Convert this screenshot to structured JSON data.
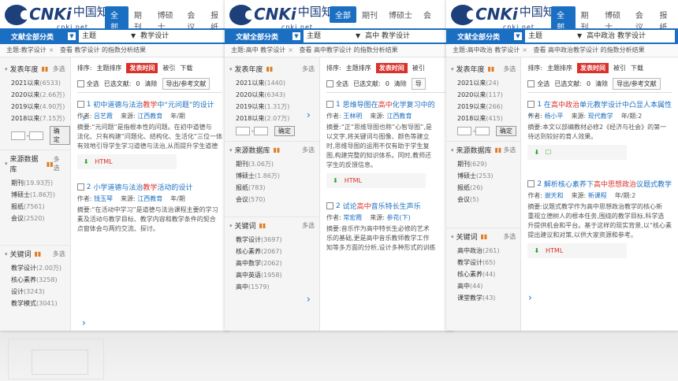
{
  "colors": {
    "accent": "#1b6fc2",
    "highlight": "#d9312a",
    "download": "#2aa52a"
  },
  "logo": {
    "brand": "CNKi",
    "chinese": "中国知网",
    "sub": "cnki.net"
  },
  "panels": [
    {
      "tabs": [
        "全部",
        "期刊",
        "博硕士",
        "会议",
        "报纸"
      ],
      "scope": "文献全部分类",
      "field": "主题",
      "search_value": "教学设计",
      "crumb": {
        "label": "主题:教学设计",
        "link": "查看 教学设计 的指数分析结果",
        "highlight": "教学设计"
      },
      "facets": {
        "year": {
          "title": "发表年度",
          "multi": "多选",
          "items": [
            [
              "2021以来",
              "(6533)"
            ],
            [
              "2020以来",
              "(2.66万)"
            ],
            [
              "2019以来",
              "(4.90万)"
            ],
            [
              "2018以来",
              "(7.15万)"
            ]
          ],
          "ok": "确定"
        },
        "source": {
          "title": "来源数据库",
          "multi": "多选",
          "items": [
            [
              "期刊",
              "(19.93万)"
            ],
            [
              "博硕士",
              "(1.86万)"
            ],
            [
              "报纸",
              "(7561)"
            ],
            [
              "会议",
              "(2520)"
            ]
          ]
        },
        "keyword": {
          "title": "关键词",
          "multi": "多选",
          "items": [
            [
              "教学设计",
              "(2.00万)"
            ],
            [
              "核心素养",
              "(3258)"
            ],
            [
              "设计",
              "(3243)"
            ],
            [
              "教学模式",
              "(3041)"
            ]
          ]
        }
      },
      "sort": {
        "label": "排序:",
        "topic": "主题排序",
        "time": "发表时间",
        "cite": "被引",
        "dl": "下载"
      },
      "selection": {
        "all": "全选",
        "selected": "已选文献:",
        "count": "0",
        "clear": "清除",
        "export": "导出/参考文献"
      },
      "results": [
        {
          "no": "1",
          "pre": "初中道德与法治",
          "hl": "教学",
          "post": "中“元问题”的设计",
          "author": "吕艺霞",
          "source": "江西教育",
          "year": "年/期",
          "abs": [
            "摘要:“元问题”是指根本性的问题。在初中道德与",
            "法化、只有构建”问题化、结构化、生活化”三位一体",
            "有效地引导学生学习道德与法治,从而提升学生道德"
          ]
        },
        {
          "no": "2",
          "pre": "小学道德与法治",
          "hl": "教学",
          "post": "活动的设计",
          "author": "钱玉琴",
          "source": "江西教育",
          "year": "年/期",
          "abs": [
            "摘要:“在活动中学习”是道德与法治课程主要的学习",
            "素及活动与教学目标、教学内容和教学条件的契合",
            "点窗体会与两约交流、探讨。"
          ]
        }
      ]
    },
    {
      "tabs": [
        "全部",
        "期刊",
        "博硕士",
        "会"
      ],
      "scope": "文献全部分类",
      "field": "主题",
      "search_value": "高中 教学设计",
      "crumb": {
        "label": "主题:高中 教学设计",
        "link": "查看 高中教学设计 的指数分析结果",
        "highlight": "高中教学设计"
      },
      "facets": {
        "year": {
          "title": "发表年度",
          "multi": "多选",
          "items": [
            [
              "2021以来",
              "(1440)"
            ],
            [
              "2020以来",
              "(6343)"
            ],
            [
              "2019以来",
              "(1.31万)"
            ],
            [
              "2018以来",
              "(2.07万)"
            ]
          ],
          "ok": "确定"
        },
        "source": {
          "title": "来源数据库",
          "multi": "多选",
          "items": [
            [
              "期刊",
              "(3.06万)"
            ],
            [
              "博硕士",
              "(1.86万)"
            ],
            [
              "报纸",
              "(783)"
            ],
            [
              "会议",
              "(570)"
            ]
          ]
        },
        "keyword": {
          "title": "关键词",
          "multi": "多选",
          "items": [
            [
              "教学设计",
              "(3697)"
            ],
            [
              "核心素养",
              "(2067)"
            ],
            [
              "高中数学",
              "(2062)"
            ],
            [
              "高中英语",
              "(1958)"
            ],
            [
              "高中",
              "(1579)"
            ]
          ]
        }
      },
      "sort": {
        "label": "排序:",
        "topic": "主题排序",
        "time": "发表时间",
        "cite": "被引",
        "dl": ""
      },
      "selection": {
        "all": "全选",
        "selected": "已选文献:",
        "count": "0",
        "clear": "清除",
        "export": "导"
      },
      "results": [
        {
          "no": "1",
          "pre": "思维导图在",
          "hl": "高中",
          "post": "化学复习中的",
          "author": "王林明",
          "source": "江西教育",
          "year": "",
          "abs": [
            "摘要:“正”思维导图也称”心智导图”,是",
            "以文字,将关键词与图像、颜色等建立",
            "时,思维导图的运用不仅有助于学生复",
            "图,构建完整的知识体系。同时,教师还",
            "学生的反馈信息。"
          ]
        },
        {
          "no": "2",
          "pre": "试论",
          "hl": "高中",
          "post": "音乐特长生声乐",
          "author": "常宏霞",
          "source": "参花(下)",
          "year": "",
          "abs": [
            "摘要:音乐作为高中特长生必修的艺术",
            "乐的基础,更是高中音乐教师教学工作",
            "知等多方面的分析,设计多种形式的训练"
          ]
        }
      ]
    },
    {
      "tabs": [
        "全部",
        "期刊",
        "博硕士",
        "会议",
        "报纸"
      ],
      "scope": "文献全部分类",
      "field": "主题",
      "search_value": "高中政治 教学设计",
      "crumb": {
        "label": "主题:高中政治 教学设计",
        "link": "查看 高中政治教学设计 的指数分析结果",
        "highlight": "高中政治教学设计"
      },
      "facets": {
        "year": {
          "title": "发表年度",
          "multi": "多选",
          "items": [
            [
              "2021以来",
              "(24)"
            ],
            [
              "2020以来",
              "(117)"
            ],
            [
              "2019以来",
              "(266)"
            ],
            [
              "2018以来",
              "(415)"
            ]
          ],
          "ok": "确定"
        },
        "source": {
          "title": "来源数据库",
          "multi": "多选",
          "items": [
            [
              "期刊",
              "(629)"
            ],
            [
              "博硕士",
              "(253)"
            ],
            [
              "报纸",
              "(26)"
            ],
            [
              "会议",
              "(5)"
            ]
          ]
        },
        "keyword": {
          "title": "关键词",
          "multi": "多选",
          "items": [
            [
              "高中政治",
              "(261)"
            ],
            [
              "教学设计",
              "(65)"
            ],
            [
              "核心素养",
              "(44)"
            ],
            [
              "高中",
              "(44)"
            ],
            [
              "课堂教学",
              "(43)"
            ]
          ]
        }
      },
      "sort": {
        "label": "排序:",
        "topic": "主题排序",
        "time": "发表时间",
        "cite": "被引",
        "dl": "下载"
      },
      "selection": {
        "all": "全选",
        "selected": "已选文献:",
        "count": "0",
        "clear": "清除",
        "export": "导出/参考文献"
      },
      "results": [
        {
          "no": "1",
          "pre": "在",
          "hl": "高中政治",
          "post": "单元教学设计中凸显人本属性",
          "author": "杨小平",
          "source": "现代教学",
          "year": "年/期:2",
          "abs": [
            "摘要:本文以部编教材必修2《经济与社会》的第一",
            "待达到较好的育人效果。"
          ]
        },
        {
          "no": "2",
          "pre": "解析核心素养下",
          "hl": "高中思想政治",
          "post": "议题式教学",
          "author": "谢天和",
          "source": "新课程",
          "year": "年/期:2",
          "abs": [
            "摘要:议题式教学作为高中思想政治教学的核心新",
            "重视立德树人的根本任务,围绕的教学目标,科学选",
            "升提供机会和平台。基于这样的现实背景,以“核心素",
            "提出建议和对策,以供大家资源和参考。"
          ]
        }
      ]
    }
  ]
}
